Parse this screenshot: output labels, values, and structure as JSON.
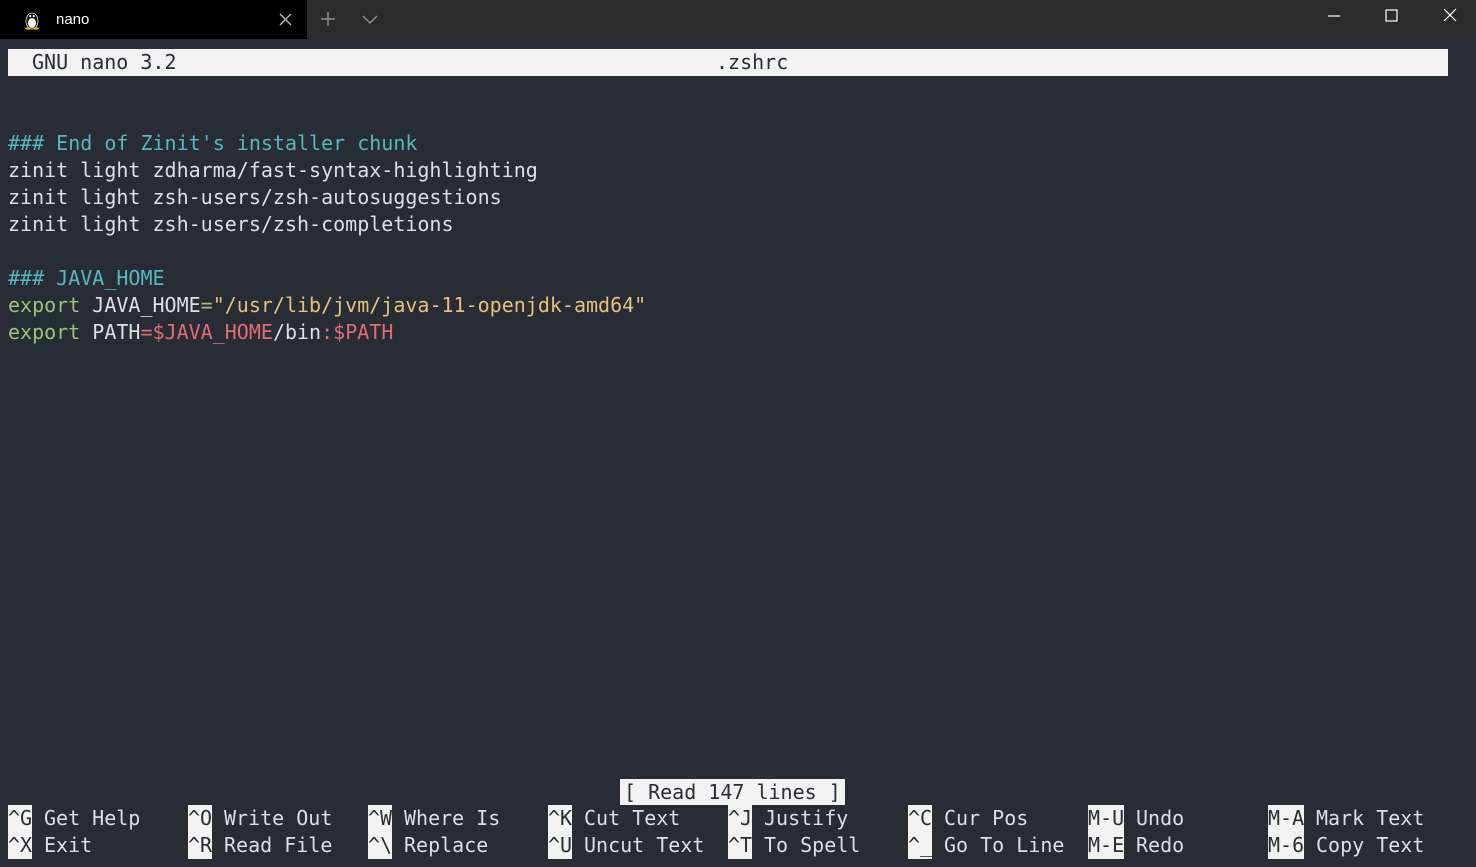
{
  "window": {
    "tab_title": "nano",
    "tab_icon": "linux-tux-icon",
    "new_tab_icon": "plus-icon",
    "dropdown_icon": "chevron-down-icon",
    "controls": [
      "minimize-icon",
      "maximize-icon",
      "close-icon"
    ]
  },
  "nano": {
    "version": "GNU nano 3.2",
    "filename": ".zshrc",
    "status": "[ Read 147 lines ]"
  },
  "editor": {
    "comment1": "### End of Zinit's installer chunk",
    "line2": "zinit light zdharma/fast-syntax-highlighting",
    "line3": "zinit light zsh-users/zsh-autosuggestions",
    "line4": "zinit light zsh-users/zsh-completions",
    "comment2": "### JAVA_HOME",
    "export1": {
      "kw": "export",
      "name": " JAVA_HOME",
      "eq": "=",
      "value": "\"/usr/lib/jvm/java-11-openjdk-amd64\""
    },
    "export2": {
      "kw": "export",
      "name": " PATH",
      "eq": "=",
      "var1": "$JAVA_HOME",
      "mid": "/bin",
      "colon": ":",
      "var2": "$PATH"
    }
  },
  "shortcuts": {
    "row1": [
      {
        "key": "^G",
        "label": "Get Help"
      },
      {
        "key": "^O",
        "label": "Write Out"
      },
      {
        "key": "^W",
        "label": "Where Is"
      },
      {
        "key": "^K",
        "label": "Cut Text"
      },
      {
        "key": "^J",
        "label": "Justify"
      },
      {
        "key": "^C",
        "label": "Cur Pos"
      },
      {
        "key": "M-U",
        "label": "Undo"
      },
      {
        "key": "M-A",
        "label": "Mark Text"
      }
    ],
    "row2": [
      {
        "key": "^X",
        "label": "Exit"
      },
      {
        "key": "^R",
        "label": "Read File"
      },
      {
        "key": "^\\",
        "label": "Replace"
      },
      {
        "key": "^U",
        "label": "Uncut Text"
      },
      {
        "key": "^T",
        "label": "To Spell"
      },
      {
        "key": "^_",
        "label": "Go To Line"
      },
      {
        "key": "M-E",
        "label": "Redo"
      },
      {
        "key": "M-6",
        "label": "Copy Text"
      }
    ]
  },
  "colors": {
    "background": "#282c34",
    "comment": "#56b6c2",
    "keyword": "#98c379",
    "string": "#e5c07b",
    "variable": "#e06c75",
    "text": "#dcdfe4"
  }
}
